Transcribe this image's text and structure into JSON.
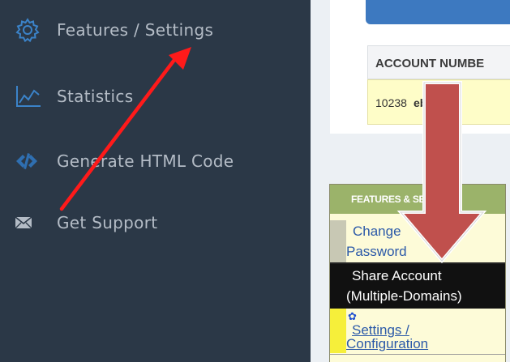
{
  "sidebar": {
    "items": [
      {
        "label": "Features / Settings",
        "icon": "gear-icon"
      },
      {
        "label": "Statistics",
        "icon": "chart-icon"
      },
      {
        "label": "Generate HTML Code",
        "icon": "code-icon"
      },
      {
        "label": "Get Support",
        "icon": "envelope-icon"
      }
    ]
  },
  "account": {
    "header": "ACCOUNT NUMBE",
    "number": "10238",
    "name": "ebmast"
  },
  "features_panel": {
    "header": "FEATURES & SETTINGS",
    "items": [
      {
        "line1": "Change",
        "line2": "Password"
      },
      {
        "line1": "Share Account",
        "line2": "(Multiple-Domains)"
      },
      {
        "line1": "Settings /",
        "line2": "Configuration"
      }
    ]
  },
  "colors": {
    "sidebar_bg": "#2b3847",
    "sidebar_text": "#b4bcc6",
    "annotation_red_arrow": "#ff1a1a",
    "annotation_block_arrow": "#c0504d",
    "panel_header": "#9bb36a"
  }
}
